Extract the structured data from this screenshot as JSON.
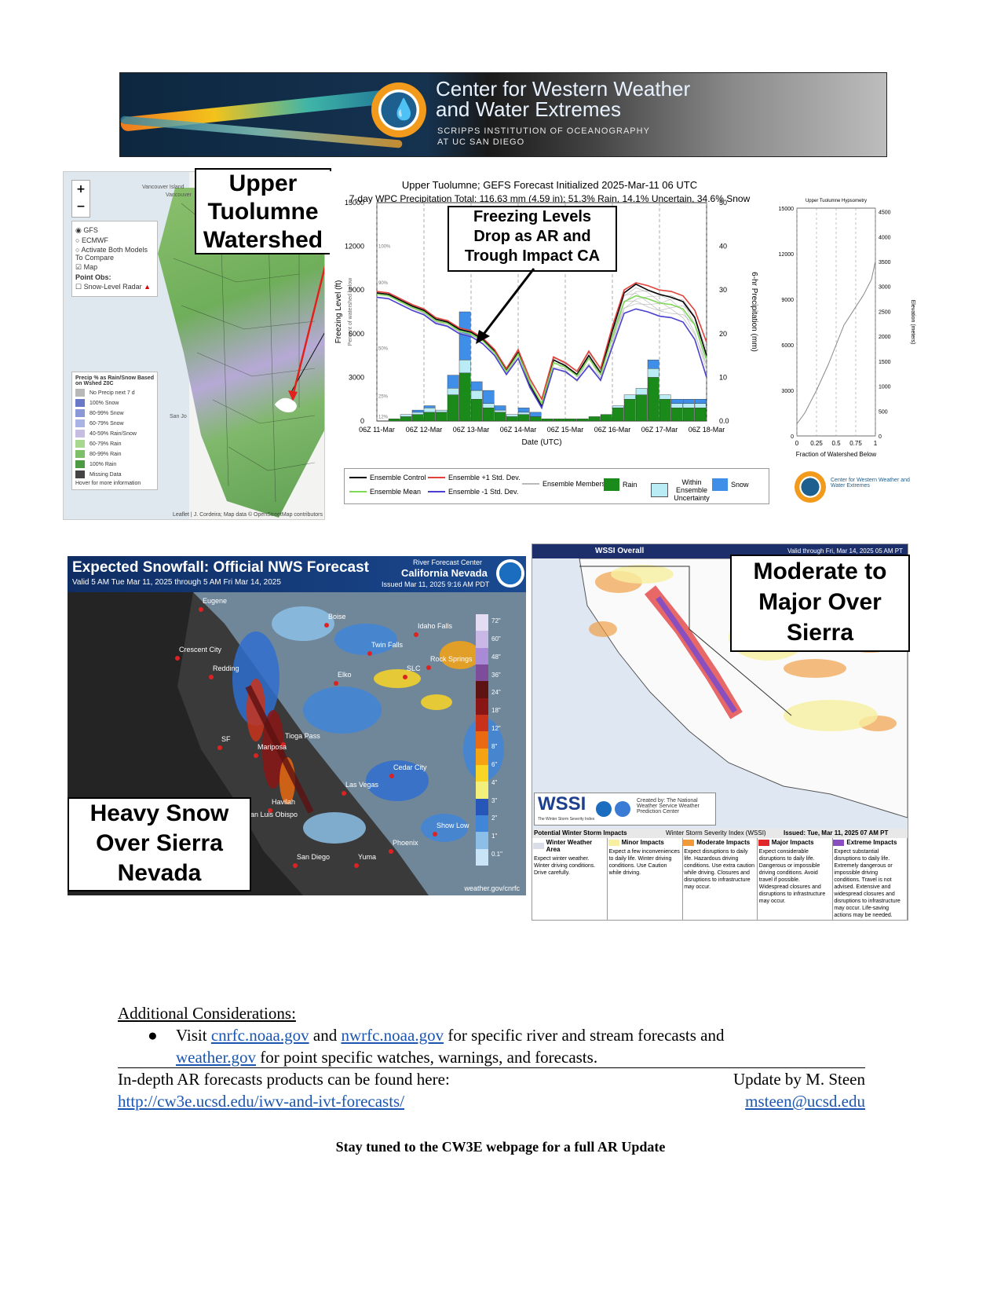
{
  "banner": {
    "title_line1": "Center for Western Weather",
    "title_line2": "and Water Extremes",
    "subtitle_line1": "SCRIPPS INSTITUTION OF OCEANOGRAPHY",
    "subtitle_line2": "AT UC SAN DIEGO"
  },
  "map_panel": {
    "zoom_in": "+",
    "zoom_out": "−",
    "model_options": [
      "GFS",
      "ECMWF",
      "Activate Both Models To Compare"
    ],
    "map_toggle": "Map",
    "point_obs_label": "Point Obs:",
    "point_obs_option": "Snow-Level Radar",
    "legend_title": "Precip % as Rain/Snow Based on Wshed Z0C",
    "legend_items": [
      {
        "label": "No Precip next 7 d",
        "color": "#b8b8b8"
      },
      {
        "label": "100% Snow",
        "color": "#6a78c8"
      },
      {
        "label": "80-99% Snow",
        "color": "#8a98d8"
      },
      {
        "label": "60-79% Snow",
        "color": "#aab4e4"
      },
      {
        "label": "40-59% Rain/Snow",
        "color": "#c7bde4"
      },
      {
        "label": "60-79% Rain",
        "color": "#a8d890"
      },
      {
        "label": "80-99% Rain",
        "color": "#7cbf68"
      },
      {
        "label": "100% Rain",
        "color": "#4c9a44"
      },
      {
        "label": "Missing Data",
        "color": "#444444"
      }
    ],
    "hover_hint": "Hover for more information",
    "attribution": "Leaflet | J. Cordeira; Map data © OpenStreetMap contributors",
    "place_labels": [
      "Vancouver Island",
      "Vancouver",
      "San Jo"
    ],
    "callout_line1": "Upper",
    "callout_line2": "Tuolumne",
    "callout_line3": "Watershed"
  },
  "chart_data": [
    {
      "type": "line",
      "title": "Upper Tuolumne; GEFS Forecast Initialized 2025-Mar-11 06 UTC",
      "subtitle": "7-day WPC Precipitation Total: 116.63 mm (4.59 in);  51.3% Rain, 14.1% Uncertain, 34.6% Snow",
      "xlabel": "Date (UTC)",
      "ylabel": "Freezing Level (ft)",
      "y2label": "6-hr Precipitation (mm)",
      "y3label": "Percent of watershed below",
      "x_ticks": [
        "06Z 11-Mar",
        "06Z 12-Mar",
        "06Z 13-Mar",
        "06Z 14-Mar",
        "06Z 15-Mar",
        "06Z 16-Mar",
        "06Z 17-Mar",
        "06Z 18-Mar"
      ],
      "y_ticks": [
        "0",
        "3000",
        "6000",
        "9000",
        "12000",
        "15000"
      ],
      "y2_ticks": [
        "0.0",
        "10",
        "20",
        "30",
        "40",
        "50"
      ],
      "pct_ticks": [
        "12%",
        "25%",
        "50%",
        "90%",
        "100%"
      ],
      "ylim": [
        0,
        15000
      ],
      "y2lim": [
        0,
        50
      ],
      "x": [
        0,
        0.25,
        0.5,
        0.75,
        1,
        1.25,
        1.5,
        1.75,
        2,
        2.25,
        2.5,
        2.75,
        3,
        3.25,
        3.5,
        3.75,
        4,
        4.25,
        4.5,
        4.75,
        5,
        5.25,
        5.5,
        5.75,
        6,
        6.25,
        6.5,
        6.75,
        7
      ],
      "series": [
        {
          "name": "Ensemble Control",
          "color": "#000000",
          "values": [
            8800,
            8700,
            8300,
            7900,
            7600,
            7000,
            6800,
            6300,
            6100,
            5600,
            4800,
            3500,
            4700,
            2500,
            1000,
            4200,
            3800,
            3200,
            4500,
            3300,
            6200,
            8800,
            9400,
            9000,
            8700,
            8500,
            8200,
            7100,
            4500
          ]
        },
        {
          "name": "Ensemble Mean",
          "color": "#7ed957",
          "values": [
            8700,
            8600,
            8200,
            7800,
            7500,
            6900,
            6700,
            6200,
            6000,
            5500,
            4700,
            3400,
            4600,
            2600,
            1200,
            4000,
            3700,
            3100,
            4300,
            3200,
            5800,
            8200,
            8600,
            8400,
            8100,
            8000,
            7700,
            6600,
            4200
          ]
        },
        {
          "name": "Ensemble +1 Std. Dev.",
          "color": "#e0413a",
          "values": [
            8900,
            8800,
            8400,
            8000,
            7700,
            7100,
            6900,
            6400,
            6200,
            5700,
            4900,
            3600,
            4900,
            2900,
            1500,
            4400,
            4000,
            3400,
            4800,
            3600,
            6500,
            9000,
            9500,
            9300,
            9000,
            8900,
            8600,
            7600,
            5400
          ]
        },
        {
          "name": "Ensemble -1 Std. Dev.",
          "color": "#4b3fcf",
          "values": [
            8500,
            8400,
            8000,
            7600,
            7300,
            6700,
            6500,
            6000,
            5800,
            5300,
            4500,
            3200,
            4300,
            2300,
            900,
            3600,
            3400,
            2800,
            3800,
            2800,
            5100,
            7400,
            7700,
            7500,
            7200,
            7100,
            6800,
            5600,
            3000
          ]
        }
      ],
      "precip_categories": [
        "06Z 11-Mar",
        "06Z 12-Mar",
        "06Z 13-Mar",
        "06Z 14-Mar",
        "06Z 15-Mar",
        "06Z 16-Mar",
        "06Z 17-Mar",
        "06Z 18-Mar"
      ],
      "precip_bars": [
        {
          "rain": 0,
          "uncertain": 0,
          "snow": 0
        },
        {
          "rain": 0.5,
          "uncertain": 0,
          "snow": 0
        },
        {
          "rain": 1,
          "uncertain": 0.5,
          "snow": 0
        },
        {
          "rain": 1.5,
          "uncertain": 0.5,
          "snow": 0.5
        },
        {
          "rain": 2,
          "uncertain": 1,
          "snow": 0.5
        },
        {
          "rain": 2,
          "uncertain": 0.5,
          "snow": 0
        },
        {
          "rain": 6,
          "uncertain": 1.5,
          "snow": 3
        },
        {
          "rain": 11,
          "uncertain": 3,
          "snow": 11
        },
        {
          "rain": 5,
          "uncertain": 2,
          "snow": 2
        },
        {
          "rain": 3,
          "uncertain": 1,
          "snow": 3
        },
        {
          "rain": 2,
          "uncertain": 0.5,
          "snow": 1
        },
        {
          "rain": 1,
          "uncertain": 0.5,
          "snow": 0
        },
        {
          "rain": 1.5,
          "uncertain": 0.5,
          "snow": 1
        },
        {
          "rain": 1,
          "uncertain": 0,
          "snow": 1
        },
        {
          "rain": 0.5,
          "uncertain": 0,
          "snow": 0
        },
        {
          "rain": 0.5,
          "uncertain": 0,
          "snow": 0
        },
        {
          "rain": 0.5,
          "uncertain": 0,
          "snow": 0
        },
        {
          "rain": 0.5,
          "uncertain": 0,
          "snow": 0
        },
        {
          "rain": 1,
          "uncertain": 0,
          "snow": 0
        },
        {
          "rain": 1.5,
          "uncertain": 0,
          "snow": 0
        },
        {
          "rain": 3,
          "uncertain": 0.5,
          "snow": 0
        },
        {
          "rain": 5,
          "uncertain": 1,
          "snow": 0
        },
        {
          "rain": 6,
          "uncertain": 1.5,
          "snow": 0
        },
        {
          "rain": 10,
          "uncertain": 2,
          "snow": 2
        },
        {
          "rain": 5,
          "uncertain": 1,
          "snow": 0
        },
        {
          "rain": 3,
          "uncertain": 1,
          "snow": 1
        },
        {
          "rain": 3,
          "uncertain": 1,
          "snow": 1
        },
        {
          "rain": 3,
          "uncertain": 1,
          "snow": 1
        }
      ],
      "legend": [
        "Ensemble Control",
        "Ensemble Mean",
        "Ensemble +1 Std. Dev.",
        "Ensemble -1 Std. Dev.",
        "Ensemble Members",
        "Rain",
        "Within Ensemble Uncertainty",
        "Snow"
      ],
      "colors": {
        "rain": "#1a8a1a",
        "uncertain": "#b9ecf5",
        "snow": "#3f8ee8",
        "members": "#bbbbbb"
      },
      "callout_line1": "Freezing Levels",
      "callout_line2": "Drop as AR and",
      "callout_line3": "Trough Impact CA"
    },
    {
      "type": "line",
      "title": "Upper Tuolumne Hypsometry",
      "xlabel": "Fraction of Watershed Below",
      "ylabel": "Elevation (feet)",
      "y2label": "Elevation (meters)",
      "x_ticks": [
        "0",
        "0.25",
        "0.5",
        "0.75",
        "1"
      ],
      "y_ticks": [
        "0",
        "3000",
        "6000",
        "9000",
        "12000",
        "15000"
      ],
      "y2_ticks": [
        "0",
        "500",
        "1000",
        "1500",
        "2000",
        "2500",
        "3000",
        "3500",
        "4000",
        "4500"
      ],
      "x": [
        0,
        0.1,
        0.25,
        0.4,
        0.5,
        0.6,
        0.75,
        0.85,
        0.95,
        1
      ],
      "values": [
        800,
        1500,
        3000,
        4700,
        6000,
        7300,
        8500,
        9300,
        10300,
        11500
      ],
      "xlim": [
        0,
        1
      ],
      "ylim": [
        0,
        15000
      ]
    }
  ],
  "cw3e_logo_text": "Center for Western Weather and Water Extremes",
  "snowfall_map": {
    "title": "Expected Snowfall: Official NWS Forecast",
    "valid": "Valid 5 AM Tue Mar 11, 2025 through 5 AM Fri Mar 14, 2025",
    "rfc_line1": "River Forecast Center",
    "rfc_line2": "California Nevada",
    "issued": "Issued Mar 11, 2025 9:16 AM PDT",
    "footer": "weather.gov/cnrfc",
    "cities": [
      "Eugene",
      "Boise",
      "Twin Falls",
      "Idaho Falls",
      "Crescent City",
      "Redding",
      "Elko",
      "SLC",
      "Rock Springs",
      "SF",
      "Tioga Pass",
      "Mariposa",
      "Cedar City",
      "Las Vegas",
      "Havilah",
      "San Luis Obispo",
      "San Diego",
      "Yuma",
      "Phoenix",
      "Show Low"
    ],
    "scale_labels": [
      "72\"",
      "60\"",
      "48\"",
      "36\"",
      "24\"",
      "18\"",
      "12\"",
      "8\"",
      "6\"",
      "4\"",
      "3\"",
      "2\"",
      "1\"",
      "0.1\""
    ],
    "scale_colors": [
      "#e4dcf2",
      "#c9b7e6",
      "#a88ad6",
      "#7d4c9a",
      "#5e1212",
      "#8a1515",
      "#c8321a",
      "#e86a12",
      "#f5a313",
      "#f9d525",
      "#f2ef7a",
      "#2556b8",
      "#3f85d8",
      "#8cbfe8",
      "#c9e4f6"
    ],
    "callout_line1": "Heavy Snow",
    "callout_line2": "Over Sierra",
    "callout_line3": "Nevada"
  },
  "wssi_map": {
    "title": "WSSI Overall",
    "valid": "Valid through Fri, Mar 14, 2025 05 AM PT",
    "logo": "WSSI",
    "logo_sub": "The Winter Storm Severity Index",
    "created_by": "Created by: The National Weather Service Weather Prediction Center",
    "legend_header": "Potential Winter Storm Impacts",
    "legend_index": "Winter Storm Severity Index (WSSI)",
    "issued": "Issued: Tue, Mar 11, 2025 07 AM PT",
    "categories": [
      {
        "label": "Winter Weather Area",
        "color": "#d9dde8",
        "desc": "Expect winter weather. Winter driving conditions. Drive carefully."
      },
      {
        "label": "Minor Impacts",
        "color": "#f7f0a0",
        "desc": "Expect a few inconveniences to daily life. Winter driving conditions. Use Caution while driving."
      },
      {
        "label": "Moderate Impacts",
        "color": "#f09a3a",
        "desc": "Expect disruptions to daily life. Hazardous driving conditions. Use extra caution while driving. Closures and disruptions to infrastructure may occur."
      },
      {
        "label": "Major Impacts",
        "color": "#e02828",
        "desc": "Expect considerable disruptions to daily life. Dangerous or impossible driving conditions. Avoid travel if possible. Widespread closures and disruptions to infrastructure may occur."
      },
      {
        "label": "Extreme Impacts",
        "color": "#8a4fbf",
        "desc": "Expect substantial disruptions to daily life. Extremely dangerous or impossible driving conditions. Travel is not advised. Extensive and widespread closures and disruptions to infrastructure may occur. Life-saving actions may be needed."
      }
    ],
    "callout_line1": "Moderate to",
    "callout_line2": "Major Over",
    "callout_line3": "Sierra"
  },
  "considerations": {
    "heading": "Additional Considerations:",
    "bullet_prefix": "Visit ",
    "link1": "cnrfc.noaa.gov",
    "mid1": " and ",
    "link2": "nwrfc.noaa.gov",
    "mid2": " for specific river and stream forecasts and",
    "link3": "weather.gov",
    "tail": " for point specific watches, warnings, and forecasts."
  },
  "footer": {
    "left_text": "In-depth AR forecasts products can be found here:",
    "right_text": "Update by M. Steen",
    "left_link": "http://cw3e.ucsd.edu/iwv-and-ivt-forecasts/",
    "right_link": "msteen@ucsd.edu",
    "closing": "Stay tuned to the CW3E webpage for a full AR Update"
  }
}
